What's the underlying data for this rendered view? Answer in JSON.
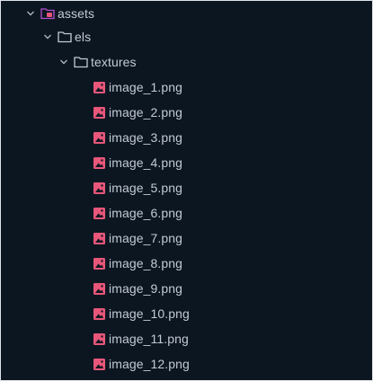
{
  "tree": {
    "assets": {
      "label": "assets",
      "expanded": true,
      "icon": "folder-special-icon"
    },
    "els": {
      "label": "els",
      "expanded": true,
      "icon": "folder-icon"
    },
    "textures": {
      "label": "textures",
      "expanded": true,
      "icon": "folder-icon"
    },
    "files": [
      {
        "label": "image_1.png",
        "icon": "image-file-icon"
      },
      {
        "label": "image_2.png",
        "icon": "image-file-icon"
      },
      {
        "label": "image_3.png",
        "icon": "image-file-icon"
      },
      {
        "label": "image_4.png",
        "icon": "image-file-icon"
      },
      {
        "label": "image_5.png",
        "icon": "image-file-icon"
      },
      {
        "label": "image_6.png",
        "icon": "image-file-icon"
      },
      {
        "label": "image_7.png",
        "icon": "image-file-icon"
      },
      {
        "label": "image_8.png",
        "icon": "image-file-icon"
      },
      {
        "label": "image_9.png",
        "icon": "image-file-icon"
      },
      {
        "label": "image_10.png",
        "icon": "image-file-icon"
      },
      {
        "label": "image_11.png",
        "icon": "image-file-icon"
      },
      {
        "label": "image_12.png",
        "icon": "image-file-icon"
      }
    ]
  },
  "colors": {
    "background": "#0b1621",
    "text": "#c3cad4",
    "image_icon": "#e8567a",
    "special_folder_icon": "#b24fcf",
    "folder_icon": "#c3cad4"
  }
}
